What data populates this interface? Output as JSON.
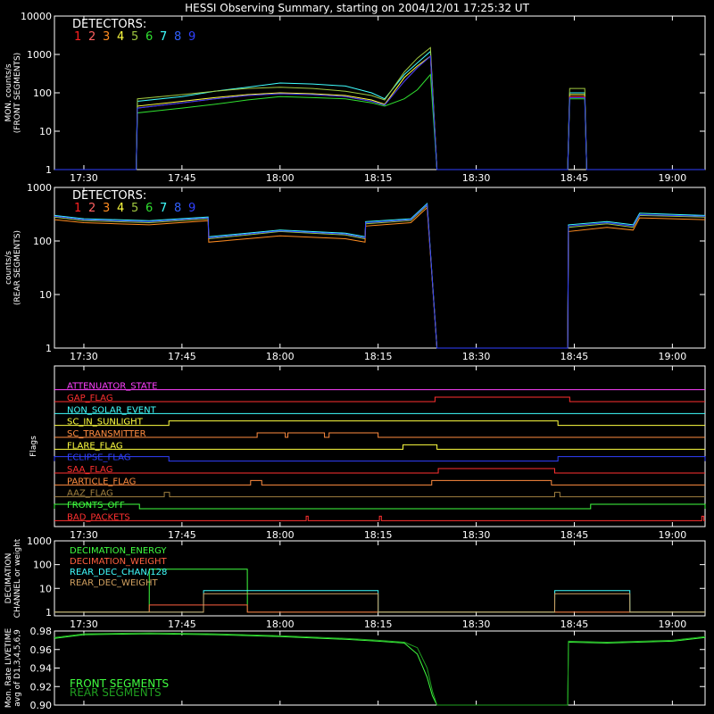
{
  "title": "HESSI Observing Summary, starting on 2004/12/01 17:25:32 UT",
  "time_ticks": [
    {
      "min": 30,
      "label": "17:30"
    },
    {
      "min": 45,
      "label": "17:45"
    },
    {
      "min": 60,
      "label": "18:00"
    },
    {
      "min": 75,
      "label": "18:15"
    },
    {
      "min": 90,
      "label": "18:30"
    },
    {
      "min": 105,
      "label": "18:45"
    },
    {
      "min": 120,
      "label": "19:00"
    }
  ],
  "detectors": {
    "heading": "DETECTORS:",
    "labels": [
      "1",
      "2",
      "3",
      "4",
      "5",
      "6",
      "7",
      "8",
      "9"
    ],
    "colors": [
      "#ff2020",
      "#ff6060",
      "#ff8c20",
      "#ffff40",
      "#a0c840",
      "#30e030",
      "#40ffff",
      "#3060ff",
      "#3040ff"
    ]
  },
  "chart_data": [
    {
      "type": "line",
      "panel": "front",
      "ylabel": "MON. counts/s\n(FRONT SEGMENTS)",
      "yscale": "log",
      "ylim": [
        1,
        10000
      ],
      "ytick_labels": [
        "1",
        "10",
        "100",
        "1000",
        "10000"
      ],
      "x_unit": "minutes after 17:00",
      "xlim": [
        25.5,
        125
      ],
      "series": [
        {
          "color": "#40ffff",
          "x": [
            25.5,
            38,
            38.2,
            45,
            50,
            55,
            60,
            65,
            70,
            74,
            76,
            79,
            81,
            83,
            84,
            104,
            104.3,
            106.6,
            106.9,
            125
          ],
          "y": [
            1,
            1,
            60,
            80,
            110,
            140,
            180,
            170,
            150,
            100,
            70,
            300,
            600,
            1200,
            1,
            1,
            100,
            100,
            1,
            1
          ]
        },
        {
          "color": "#ffff40",
          "x": [
            25.5,
            38,
            38.2,
            45,
            50,
            55,
            60,
            65,
            70,
            74,
            76,
            79,
            81,
            83,
            84,
            104,
            104.3,
            106.6,
            106.9,
            125
          ],
          "y": [
            1,
            1,
            45,
            60,
            75,
            90,
            100,
            95,
            85,
            65,
            50,
            250,
            500,
            900,
            1,
            1,
            90,
            90,
            1,
            1
          ]
        },
        {
          "color": "#a0c840",
          "x": [
            25.5,
            38,
            38.2,
            45,
            50,
            55,
            60,
            65,
            70,
            74,
            76,
            79,
            81,
            83,
            84,
            104,
            104.3,
            106.6,
            106.9,
            125
          ],
          "y": [
            1,
            1,
            70,
            90,
            110,
            130,
            140,
            130,
            110,
            85,
            65,
            350,
            800,
            1500,
            1,
            1,
            130,
            130,
            1,
            1
          ]
        },
        {
          "color": "#ff2020",
          "x": [
            25.5,
            38,
            38.2,
            45,
            50,
            55,
            60,
            65,
            70,
            74,
            76,
            79,
            81,
            83,
            84,
            104,
            104.3,
            106.6,
            106.9,
            125
          ],
          "y": [
            1,
            1,
            40,
            55,
            70,
            85,
            95,
            90,
            80,
            60,
            48,
            200,
            450,
            900,
            1,
            1,
            80,
            80,
            1,
            1
          ]
        },
        {
          "color": "#30e030",
          "x": [
            25.5,
            38,
            38.2,
            45,
            50,
            55,
            60,
            65,
            70,
            74,
            76,
            79,
            81,
            83,
            84,
            104,
            104.3,
            106.6,
            106.9,
            125
          ],
          "y": [
            1,
            1,
            30,
            40,
            50,
            65,
            80,
            75,
            70,
            55,
            45,
            70,
            120,
            300,
            1,
            1,
            70,
            70,
            1,
            1
          ]
        },
        {
          "color": "#3040ff",
          "x": [
            25.5,
            38,
            38.2,
            45,
            50,
            55,
            60,
            65,
            70,
            74,
            76,
            79,
            81,
            83,
            84,
            104,
            104.3,
            106.6,
            106.9,
            125
          ],
          "y": [
            1,
            1,
            40,
            55,
            70,
            85,
            95,
            90,
            80,
            60,
            48,
            200,
            450,
            900,
            1,
            1,
            75,
            75,
            1,
            1
          ]
        }
      ]
    },
    {
      "type": "line",
      "panel": "rear",
      "ylabel": "counts/s\n(REAR SEGMENTS)",
      "yscale": "log",
      "ylim": [
        1,
        1000
      ],
      "ytick_labels": [
        "1",
        "10",
        "100",
        "1000"
      ],
      "x_unit": "minutes after 17:00",
      "xlim": [
        25.5,
        125
      ],
      "series": [
        {
          "color": "#40ffff",
          "x": [
            25.5,
            30,
            40,
            49,
            49.1,
            55,
            60,
            70,
            73,
            73.1,
            80,
            82.5,
            84,
            84.1,
            104,
            104.1,
            110,
            114,
            115,
            125
          ],
          "y": [
            300,
            260,
            240,
            280,
            120,
            140,
            160,
            140,
            120,
            230,
            260,
            500,
            1,
            1,
            1,
            200,
            230,
            200,
            330,
            300
          ]
        },
        {
          "color": "#a0c840",
          "x": [
            25.5,
            30,
            40,
            49,
            49.1,
            55,
            60,
            70,
            73,
            73.1,
            80,
            82.5,
            84,
            84.1,
            104,
            104.1,
            110,
            114,
            115,
            125
          ],
          "y": [
            280,
            240,
            220,
            260,
            110,
            130,
            150,
            130,
            110,
            210,
            240,
            460,
            1,
            1,
            1,
            180,
            210,
            180,
            300,
            280
          ]
        },
        {
          "color": "#ff8c20",
          "x": [
            25.5,
            30,
            40,
            49,
            49.1,
            55,
            60,
            70,
            73,
            73.1,
            80,
            82.5,
            84,
            84.1,
            104,
            104.1,
            110,
            114,
            115,
            125
          ],
          "y": [
            250,
            220,
            200,
            240,
            95,
            110,
            125,
            110,
            95,
            190,
            220,
            420,
            1,
            1,
            1,
            150,
            180,
            160,
            270,
            250
          ]
        },
        {
          "color": "#3040ff",
          "x": [
            25.5,
            30,
            40,
            49,
            49.1,
            55,
            60,
            70,
            73,
            73.1,
            80,
            82.5,
            84,
            84.1,
            104,
            104.1,
            110,
            114,
            115,
            125
          ],
          "y": [
            290,
            250,
            230,
            270,
            115,
            135,
            155,
            135,
            115,
            220,
            250,
            480,
            1,
            1,
            1,
            190,
            220,
            190,
            310,
            290
          ]
        }
      ]
    },
    {
      "type": "line",
      "panel": "flags",
      "ylabel": "Flags",
      "x_unit": "minutes after 17:00",
      "xlim": [
        25.5,
        125
      ],
      "series": [
        {
          "name": "ATTENUATOR_STATE",
          "color": "#ff40ff",
          "intervals": []
        },
        {
          "name": "GAP_FLAG",
          "color": "#ff3030",
          "intervals": [
            [
              83.7,
              104.3
            ]
          ]
        },
        {
          "name": "NON_SOLAR_EVENT",
          "color": "#40ffff",
          "intervals": []
        },
        {
          "name": "SC_IN_SUNLIGHT",
          "color": "#ffff40",
          "intervals": [
            [
              43,
              102.5
            ]
          ]
        },
        {
          "name": "SC_TRANSMITTER",
          "color": "#ff8c40",
          "intervals": [
            [
              56.5,
              60.8
            ],
            [
              61.2,
              66.8
            ],
            [
              67.5,
              75
            ]
          ]
        },
        {
          "name": "FLARE_FLAG",
          "color": "#ffff40",
          "intervals": [
            [
              78.8,
              84
            ]
          ]
        },
        {
          "name": "ECLIPSE_FLAG",
          "color": "#3040ff",
          "intervals": [
            [
              25.5,
              43
            ],
            [
              102.5,
              125
            ]
          ]
        },
        {
          "name": "SAA_FLAG",
          "color": "#ff3030",
          "intervals": [
            [
              84.2,
              102
            ]
          ]
        },
        {
          "name": "PARTICLE_FLAG",
          "color": "#ff8c40",
          "intervals": [
            [
              55.5,
              57.2
            ],
            [
              83.2,
              101.5
            ]
          ]
        },
        {
          "name": "AAZ_FLAG",
          "color": "#a08040",
          "intervals": [
            [
              42.3,
              43.1
            ],
            [
              102,
              102.8
            ]
          ]
        },
        {
          "name": "FRONTS_OFF",
          "color": "#40ff40",
          "intervals": [
            [
              25.5,
              38.5
            ],
            [
              107.5,
              125
            ]
          ]
        },
        {
          "name": "BAD_PACKETS",
          "color": "#ff3030",
          "intervals": [
            [
              64,
              64.3
            ],
            [
              75.2,
              75.5
            ],
            [
              124.5,
              124.8
            ]
          ]
        }
      ]
    },
    {
      "type": "line",
      "panel": "decimation",
      "ylabel": "DECIMATION\nCHANNEL or weight",
      "yscale": "log",
      "ylim": [
        0.7,
        1000
      ],
      "ytick_labels": [
        "1",
        "10",
        "100",
        "1000"
      ],
      "x_unit": "minutes after 17:00",
      "xlim": [
        25.5,
        125
      ],
      "series": [
        {
          "name": "DECIMATION_ENERGY",
          "color": "#40ff40",
          "x": [
            25.5,
            40,
            40.01,
            55,
            55.01,
            125
          ],
          "y": [
            1,
            1,
            64,
            64,
            1,
            1
          ]
        },
        {
          "name": "DECIMATION_WEIGHT",
          "color": "#ff6040",
          "x": [
            25.5,
            40,
            40.01,
            55,
            55.01,
            125
          ],
          "y": [
            1,
            1,
            2,
            2,
            1,
            1
          ]
        },
        {
          "name": "REAR_DEC_CHAN/128",
          "color": "#40ffff",
          "x": [
            25.5,
            48.3,
            48.31,
            75,
            75.01,
            102,
            102.01,
            113.5,
            113.51,
            125
          ],
          "y": [
            1,
            1,
            8,
            8,
            1,
            1,
            8,
            8,
            1,
            1
          ]
        },
        {
          "name": "REAR_DEC_WEIGHT",
          "color": "#d0a060",
          "x": [
            25.5,
            48.3,
            48.31,
            75,
            75.01,
            102,
            102.01,
            113.5,
            113.51,
            125
          ],
          "y": [
            1,
            1,
            6,
            6,
            1,
            1,
            6,
            6,
            1,
            1
          ]
        }
      ]
    },
    {
      "type": "line",
      "panel": "livetime",
      "ylabel": "Mon. Rate LIVETIME\navg of D1,3,4,5,6,9",
      "ylim": [
        0.9,
        0.98
      ],
      "ytick_labels": [
        "0.90",
        "0.92",
        "0.94",
        "0.96",
        "0.98"
      ],
      "x_unit": "minutes after 17:00",
      "xlim": [
        25.5,
        125
      ],
      "series": [
        {
          "name": "FRONT SEGMENTS",
          "color": "#40ff40",
          "x": [
            25.5,
            30,
            40,
            50,
            60,
            70,
            75,
            79,
            81,
            82.5,
            83.3,
            84,
            84.1,
            104,
            104.1,
            110,
            120,
            125
          ],
          "y": [
            0.972,
            0.976,
            0.977,
            0.976,
            0.974,
            0.971,
            0.969,
            0.967,
            0.955,
            0.93,
            0.91,
            0.9,
            0.9,
            0.9,
            0.968,
            0.967,
            0.969,
            0.973
          ]
        },
        {
          "name": "REAR SEGMENTS",
          "color": "#20a020",
          "x": [
            25.5,
            30,
            40,
            50,
            60,
            70,
            75,
            79,
            81,
            82.5,
            83.3,
            84,
            84.1,
            104,
            104.1,
            110,
            120,
            125
          ],
          "y": [
            0.973,
            0.977,
            0.978,
            0.977,
            0.975,
            0.972,
            0.97,
            0.968,
            0.962,
            0.94,
            0.915,
            0.9,
            0.9,
            0.9,
            0.969,
            0.968,
            0.97,
            0.974
          ]
        }
      ]
    }
  ]
}
